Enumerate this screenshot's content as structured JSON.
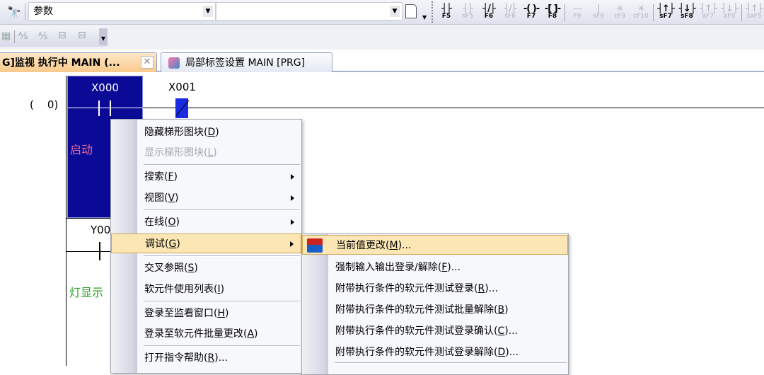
{
  "toolbar": {
    "search_combo": "参数",
    "second_combo": "",
    "fkeys": [
      {
        "glyph": "┤├",
        "label": "F5",
        "enabled": true
      },
      {
        "glyph": "┤├",
        "label": "sF5",
        "enabled": false
      },
      {
        "glyph": "┤/├",
        "label": "F6",
        "enabled": true
      },
      {
        "glyph": "┤/├",
        "label": "sF6",
        "enabled": false
      },
      {
        "glyph": "-( )-",
        "label": "F7",
        "enabled": true
      },
      {
        "glyph": "-[ ]-",
        "label": "F8",
        "enabled": true
      },
      {
        "glyph": "—",
        "label": "F9",
        "enabled": false
      },
      {
        "glyph": "|",
        "label": "sF9",
        "enabled": false
      },
      {
        "glyph": "✳",
        "label": "cF9",
        "enabled": false
      },
      {
        "glyph": "✳",
        "label": "cF10",
        "enabled": false
      },
      {
        "glyph": "┤↑├",
        "label": "sF7",
        "enabled": true
      },
      {
        "glyph": "┤↓├",
        "label": "sF8",
        "enabled": true
      },
      {
        "glyph": "┤↑├",
        "label": "aF7",
        "enabled": false
      },
      {
        "glyph": "┤↓├",
        "label": "aF8",
        "enabled": false
      },
      {
        "glyph": "┤↑├",
        "label": "saF5",
        "enabled": false
      }
    ]
  },
  "tabs": [
    {
      "label": "G]监视 执行中 MAIN (...",
      "active": true
    },
    {
      "label": "局部标签设置 MAIN [PRG]",
      "active": false
    }
  ],
  "ladder": {
    "step": "(    0)",
    "contacts": [
      {
        "device": "X000",
        "comment": "启动"
      },
      {
        "device": "X001",
        "comment": ""
      },
      {
        "device": "Y00",
        "comment": "灯显示"
      }
    ]
  },
  "context_menu": {
    "items": [
      {
        "label": "隐藏梯形图块",
        "key": "D",
        "suffix": ""
      },
      {
        "label": "显示梯形图块",
        "key": "L",
        "suffix": "",
        "disabled": true
      },
      {
        "label": "搜索",
        "key": "F",
        "suffix": ""
      },
      {
        "label": "视图",
        "key": "V",
        "suffix": ""
      },
      {
        "label": "在线",
        "key": "O",
        "suffix": ""
      },
      {
        "label": "调试",
        "key": "G",
        "suffix": ""
      },
      {
        "label": "交叉参照",
        "key": "S",
        "suffix": ""
      },
      {
        "label": "软元件使用列表",
        "key": "I",
        "suffix": ""
      },
      {
        "label": "登录至监看窗口",
        "key": "H",
        "suffix": ""
      },
      {
        "label": "登录至软元件批量更改",
        "key": "A",
        "suffix": ""
      },
      {
        "label": "打开指令帮助",
        "key": "R",
        "suffix": "..."
      }
    ]
  },
  "submenu": {
    "items": [
      {
        "label": "当前值更改",
        "key": "M",
        "suffix": "..."
      },
      {
        "label": "强制输入输出登录/解除",
        "key": "F",
        "suffix": "..."
      },
      {
        "label": "附带执行条件的软元件测试登录",
        "key": "R",
        "suffix": "..."
      },
      {
        "label": "附带执行条件的软元件测试批量解除",
        "key": "B",
        "suffix": ""
      },
      {
        "label": "附带执行条件的软元件测试登录确认",
        "key": "C",
        "suffix": "..."
      },
      {
        "label": "附带执行条件的软元件测试登录解除",
        "key": "D",
        "suffix": "..."
      }
    ]
  }
}
